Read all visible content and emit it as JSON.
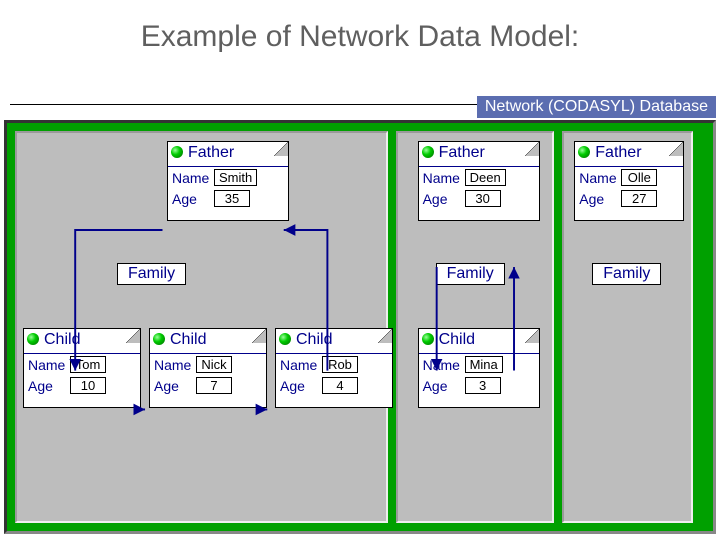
{
  "title": "Example of Network Data Model:",
  "db_title": "Network (CODASYL) Database",
  "setlabel": "Family",
  "labels": {
    "father": "Father",
    "child": "Child",
    "name": "Name",
    "age": "Age"
  },
  "columns": [
    {
      "father": {
        "name": "Smith",
        "age": "35"
      },
      "children": [
        {
          "name": "Tom",
          "age": "10"
        },
        {
          "name": "Nick",
          "age": "7"
        },
        {
          "name": "Rob",
          "age": "4"
        }
      ]
    },
    {
      "father": {
        "name": "Deen",
        "age": "30"
      },
      "children": [
        {
          "name": "Mina",
          "age": "3"
        }
      ]
    },
    {
      "father": {
        "name": "Olle",
        "age": "27"
      },
      "children": []
    }
  ]
}
